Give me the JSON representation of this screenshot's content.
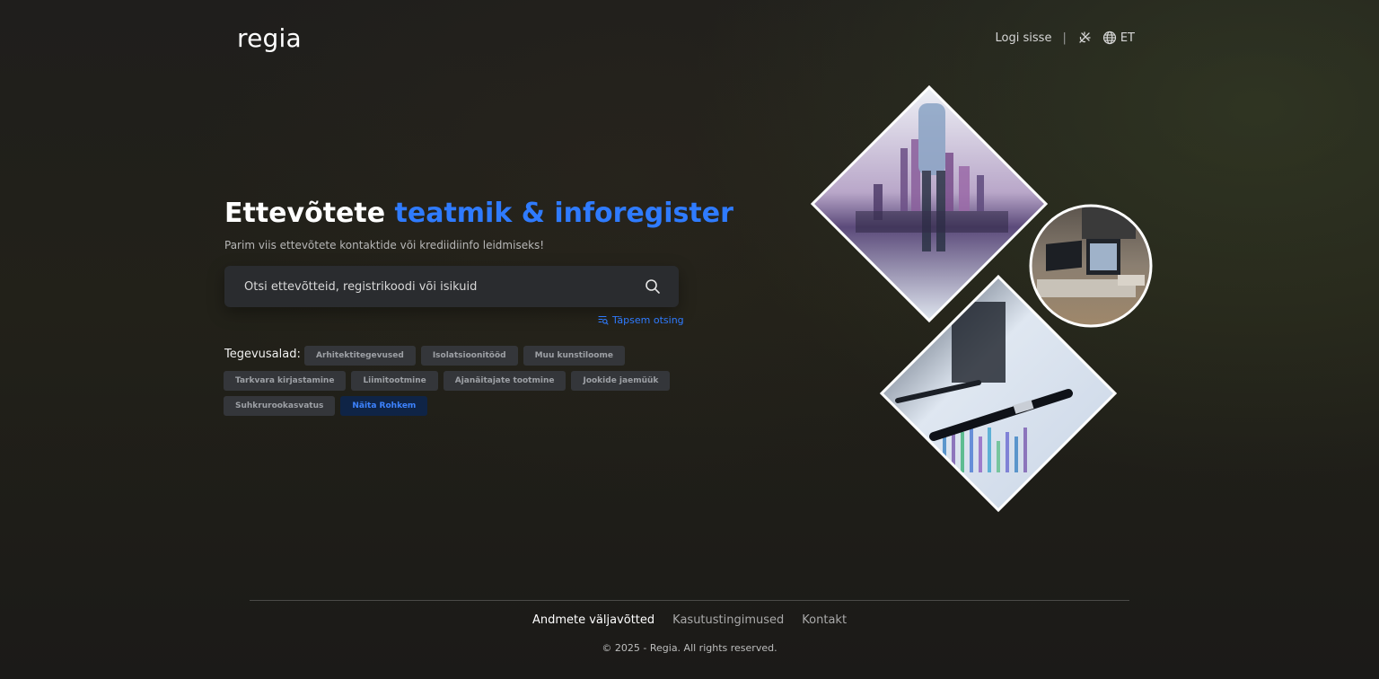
{
  "header": {
    "logo": "regia",
    "login_label": "Logi sisse",
    "separator": "|",
    "theme_icon": "theme-toggle-icon",
    "language_icon": "globe-icon",
    "language_label": "ET"
  },
  "hero": {
    "title_main": "Ettevõtete",
    "title_accent": "teatmik & inforegister",
    "subtitle": "Parim viis ettevõtete kontaktide või krediidiinfo leidmiseks!",
    "accent_color": "#2f7bff"
  },
  "search": {
    "placeholder": "Otsi ettevõtteid, registrikoodi või isikuid",
    "icon": "search-icon",
    "advanced_label": "Täpsem otsing"
  },
  "categories": {
    "label": "Tegevusalad:",
    "items": [
      "Arhitektitegevused",
      "Isolatsioonitööd",
      "Muu kunstiloome",
      "Tarkvara kirjastamine",
      "Liimitootmine",
      "Ajanäitajate tootmine",
      "Jookide jaemüük",
      "Suhkruroo­kasvatus",
      "Näita Rohkem"
    ]
  },
  "footer": {
    "links": [
      "Andmete väljavõtted",
      "Kasutustingimused",
      "Kontakt"
    ],
    "copyright": "© 2025 - Regia. All rights reserved."
  }
}
